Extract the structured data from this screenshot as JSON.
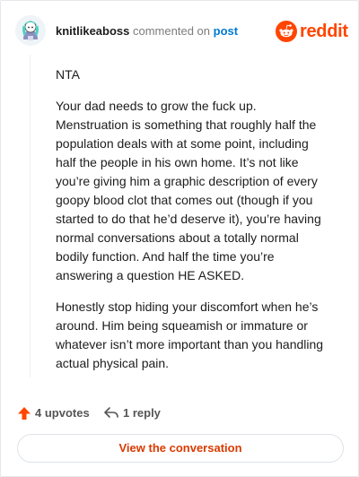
{
  "header": {
    "username": "knitlikeaboss",
    "action_text": "commented on",
    "post_link": "post",
    "brand_name": "reddit"
  },
  "comment": {
    "paragraphs": [
      "NTA",
      "Your dad needs to grow the fuck up. Menstruation is something that roughly half the population deals with at some point, including half the people in his own home. It’s not like you’re giving him a graphic description of every goopy blood clot that comes out (though if you started to do that he’d deserve it), you’re having normal conversations about a totally normal bodily function. And half the time you’re answering a question HE ASKED.",
      "Honestly stop hiding your discomfort when he’s around. Him being squeamish or immature or whatever isn’t more important than you handling actual physical pain."
    ]
  },
  "actions": {
    "upvotes": "4 upvotes",
    "replies": "1 reply"
  },
  "cta": {
    "label": "View the conversation"
  },
  "colors": {
    "brand": "#ff4500",
    "link": "#0079d3",
    "cta_text": "#d93a00"
  },
  "icons": [
    "user-avatar",
    "reddit-logo-icon",
    "upvote-arrow-icon",
    "reply-icon"
  ]
}
